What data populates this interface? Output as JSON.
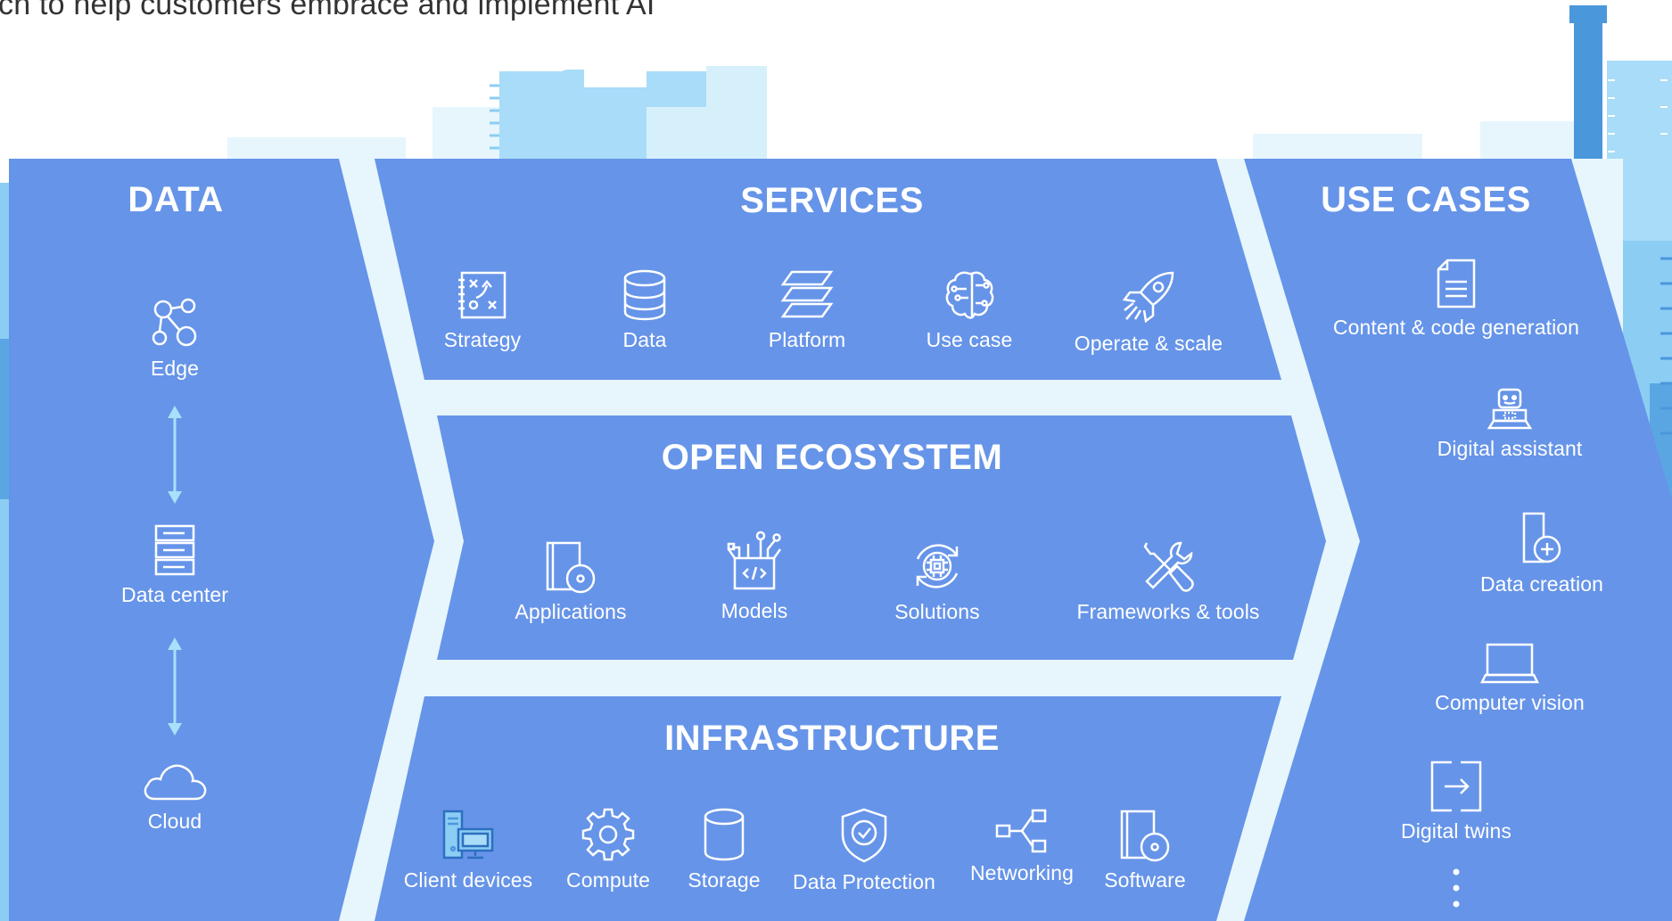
{
  "headline": "ch to help customers embrace and implement AI",
  "colors": {
    "panel": "#6694e8",
    "band_light": "#e6f6fc",
    "city_light": "#a8dcf8",
    "city_mid": "#8ccdf4",
    "city_dark": "#4a97dc",
    "arrow": "#a9e0fa",
    "icon_stroke": "#ffffff"
  },
  "data_column": {
    "title": "DATA",
    "items": [
      {
        "label": "Edge",
        "icon": "edge-nodes-icon"
      },
      {
        "label": "Data center",
        "icon": "server-rack-icon"
      },
      {
        "label": "Cloud",
        "icon": "cloud-icon"
      }
    ]
  },
  "services": {
    "title": "SERVICES",
    "items": [
      {
        "label": "Strategy",
        "icon": "strategy-board-icon"
      },
      {
        "label": "Data",
        "icon": "database-icon"
      },
      {
        "label": "Platform",
        "icon": "platform-layers-icon"
      },
      {
        "label": "Use case",
        "icon": "brain-circuit-icon"
      },
      {
        "label": "Operate & scale",
        "icon": "rocket-icon"
      }
    ]
  },
  "open_ecosystem": {
    "title": "OPEN ECOSYSTEM",
    "items": [
      {
        "label": "Applications",
        "icon": "application-disc-icon"
      },
      {
        "label": "Models",
        "icon": "code-box-icon"
      },
      {
        "label": "Solutions",
        "icon": "chip-cycle-icon"
      },
      {
        "label": "Frameworks & tools",
        "icon": "wrench-screwdriver-icon"
      }
    ]
  },
  "infrastructure": {
    "title": "INFRASTRUCTURE",
    "items": [
      {
        "label": "Client devices",
        "icon": "client-devices-icon"
      },
      {
        "label": "Compute",
        "icon": "gear-icon"
      },
      {
        "label": "Storage",
        "icon": "storage-cylinder-icon"
      },
      {
        "label": "Data Protection",
        "icon": "shield-check-icon"
      },
      {
        "label": "Networking",
        "icon": "network-nodes-icon"
      },
      {
        "label": "Software",
        "icon": "software-disc-icon"
      }
    ]
  },
  "use_cases": {
    "title": "USE CASES",
    "items": [
      {
        "label": "Content & code generation",
        "icon": "document-icon"
      },
      {
        "label": "Digital assistant",
        "icon": "robot-laptop-icon"
      },
      {
        "label": "Data creation",
        "icon": "file-plus-icon"
      },
      {
        "label": "Computer vision",
        "icon": "laptop-icon"
      },
      {
        "label": "Digital twins",
        "icon": "twin-arrow-icon"
      }
    ],
    "more_icon": "vertical-ellipsis-icon"
  }
}
